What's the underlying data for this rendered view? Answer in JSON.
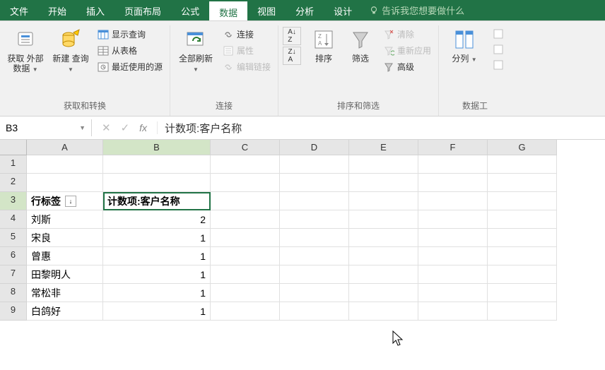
{
  "menu": {
    "tabs": [
      "文件",
      "开始",
      "插入",
      "页面布局",
      "公式",
      "数据",
      "视图",
      "分析",
      "设计"
    ],
    "active_index": 5,
    "tellme": "告诉我您想要做什么"
  },
  "ribbon": {
    "groups": [
      {
        "label": "获取和转换",
        "big": [
          {
            "name": "get-external-data",
            "label": "获取\n外部数据",
            "dd": true
          },
          {
            "name": "new-query",
            "label": "新建\n查询",
            "dd": true
          }
        ],
        "small": [
          "显示查询",
          "从表格",
          "最近使用的源"
        ]
      },
      {
        "label": "连接",
        "big": [
          {
            "name": "refresh-all",
            "label": "全部刷新",
            "dd": true
          }
        ],
        "small": [
          "连接",
          "属性",
          "编辑链接"
        ]
      },
      {
        "label": "排序和筛选",
        "big": [
          {
            "name": "sort-az",
            "label": ""
          },
          {
            "name": "sort",
            "label": "排序"
          },
          {
            "name": "filter",
            "label": "筛选"
          }
        ],
        "small": [
          "清除",
          "重新应用",
          "高级"
        ]
      },
      {
        "label": "数据工",
        "big": [
          {
            "name": "text-to-columns",
            "label": "分列",
            "dd": true
          }
        ]
      }
    ]
  },
  "formula_bar": {
    "namebox": "B3",
    "formula": "计数项:客户名称"
  },
  "sheet": {
    "columns": [
      "A",
      "B",
      "C",
      "D",
      "E",
      "F",
      "G"
    ],
    "pivot": {
      "row_label_header": "行标签",
      "value_header": "计数项:客户名称"
    },
    "rows": [
      {
        "r": 1
      },
      {
        "r": 2
      },
      {
        "r": 3,
        "a": "行标签",
        "b": "计数项:客户名称",
        "pivot_header": true
      },
      {
        "r": 4,
        "a": "刘斯",
        "b": "2"
      },
      {
        "r": 5,
        "a": "宋良",
        "b": "1"
      },
      {
        "r": 6,
        "a": "曾惠",
        "b": "1"
      },
      {
        "r": 7,
        "a": "田黎明人",
        "b": "1"
      },
      {
        "r": 8,
        "a": "常松非",
        "b": "1"
      },
      {
        "r": 9,
        "a": "白鸽好",
        "b": "1"
      }
    ]
  },
  "chart_data": {
    "type": "table",
    "title": "计数项:客户名称",
    "columns": [
      "行标签",
      "计数项:客户名称"
    ],
    "rows": [
      [
        "刘斯",
        2
      ],
      [
        "宋良",
        1
      ],
      [
        "曾惠",
        1
      ],
      [
        "田黎明人",
        1
      ],
      [
        "常松非",
        1
      ],
      [
        "白鸽好",
        1
      ]
    ]
  }
}
